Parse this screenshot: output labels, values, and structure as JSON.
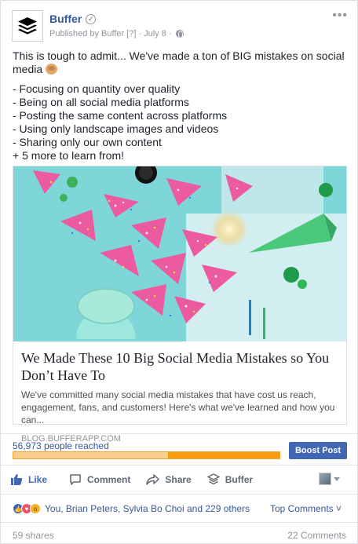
{
  "post": {
    "page_name": "Buffer",
    "published_by": "Published by Buffer",
    "bracket": "[?]",
    "date": "July 8",
    "dot": "·",
    "menu": "•••",
    "intro": "This is tough to admit... We've made a ton of BIG mistakes on social media",
    "list": [
      "- Focusing on quantity over quality",
      "- Being on all social media platforms",
      "- Posting the same content across platforms",
      "- Using only landscape images and videos",
      "- Sharing only our own content",
      "+ 5 more to learn from!"
    ]
  },
  "link_preview": {
    "title": "We Made These 10 Big Social Media Mistakes so You Don’t Have To",
    "description": "We've committed many social media mistakes that have cost us reach, engagement, fans, and customers! Here's what we've learned and how you can...",
    "domain": "BLOG.BUFFERAPP.COM"
  },
  "reach": {
    "label": "56,973 people reached",
    "organic_fraction": 0.58,
    "boost_label": "Boost Post"
  },
  "actions": {
    "like": "Like",
    "comment": "Comment",
    "share": "Share",
    "buffer": "Buffer"
  },
  "reactions": {
    "text": "You, Brian Peters, Sylvia Bo Choi and 229 others",
    "top_comments": "Top Comments ˅"
  },
  "footer": {
    "shares": "59 shares",
    "comments": "22 Comments"
  },
  "colors": {
    "link": "#365899",
    "boost": "#4267b2",
    "reach_paid": "#f89c10",
    "reach_organic": "#fbce8b"
  }
}
